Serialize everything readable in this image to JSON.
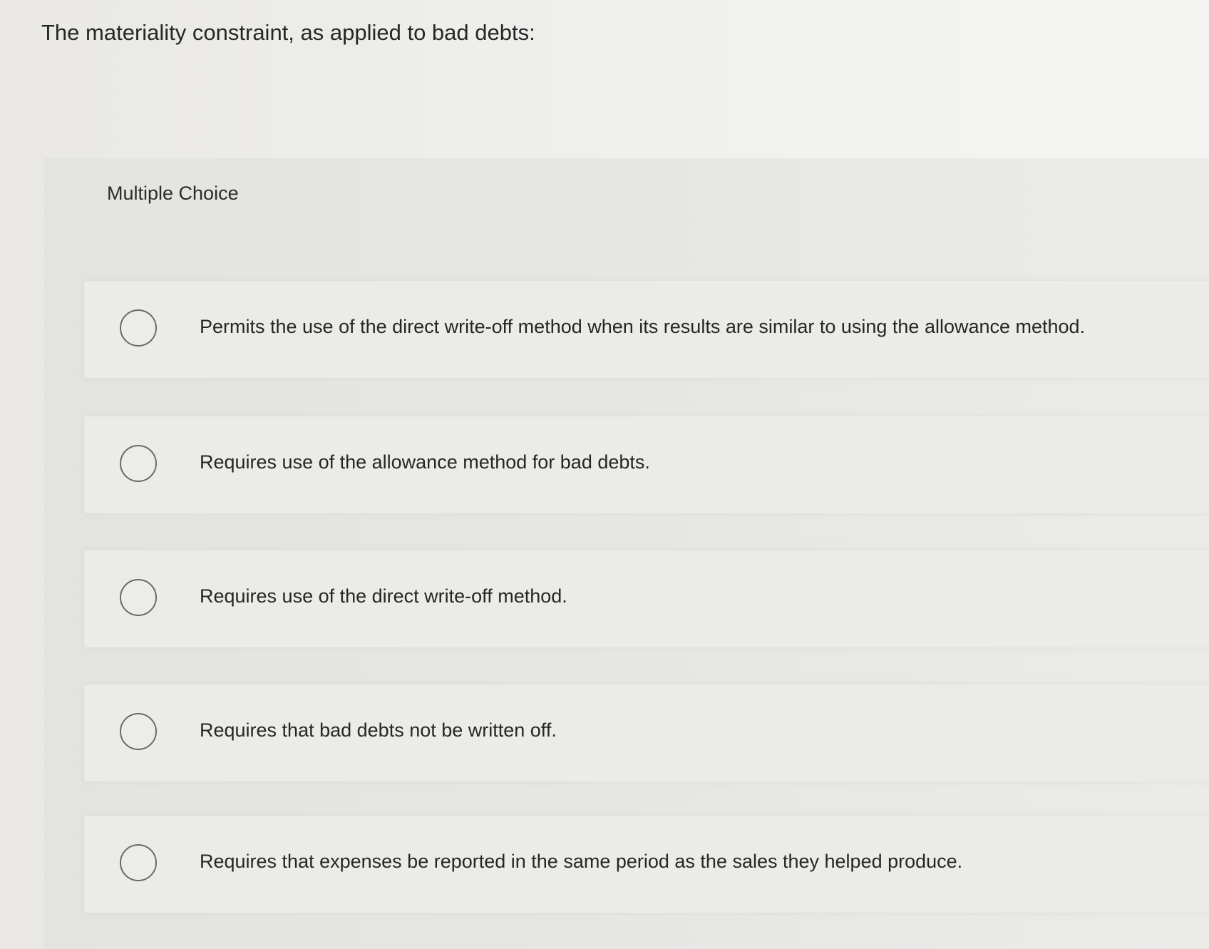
{
  "question": {
    "text": "The materiality constraint, as applied to bad debts:"
  },
  "multiple_choice": {
    "label": "Multiple Choice",
    "options": [
      {
        "text": "Permits the use of the direct write-off method when its results are similar to using the allowance method.",
        "selected": false
      },
      {
        "text": "Requires use of the allowance method for bad debts.",
        "selected": false
      },
      {
        "text": "Requires use of the direct write-off method.",
        "selected": false
      },
      {
        "text": "Requires that bad debts not be written off.",
        "selected": false
      },
      {
        "text": "Requires that expenses be reported in the same period as the sales they helped produce.",
        "selected": false
      }
    ]
  }
}
